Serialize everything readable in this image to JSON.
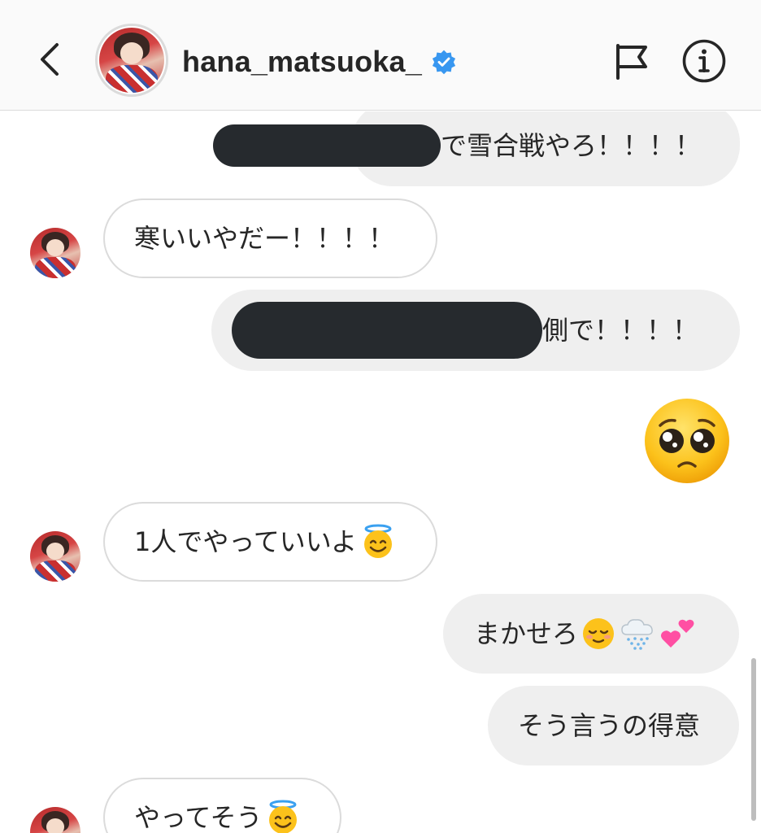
{
  "header": {
    "username": "hana_matsuoka_",
    "verified": true,
    "icons": [
      "back-icon",
      "verified-badge-icon",
      "flag-icon",
      "info-icon"
    ],
    "accent_color": "#3897f0"
  },
  "messages": [
    {
      "direction": "outgoing",
      "redacted": true,
      "text": "で雪合戦やろ！！！！"
    },
    {
      "direction": "incoming",
      "text": "寒いいやだー！！！！"
    },
    {
      "direction": "outgoing",
      "redacted": true,
      "text": "側で！！！！"
    },
    {
      "direction": "outgoing",
      "emoji_only": "pleading-face-emoji"
    },
    {
      "direction": "incoming",
      "text": "1人でやっていいよ",
      "emoji": "smiling-face-with-halo-emoji"
    },
    {
      "direction": "outgoing",
      "text": "まかせろ",
      "emoji": [
        "relieved-face-emoji",
        "cloud-with-snow-emoji",
        "two-hearts-emoji"
      ]
    },
    {
      "direction": "outgoing",
      "text": "そう言うの得意"
    },
    {
      "direction": "incoming",
      "text": "やってそう",
      "emoji": "smiling-face-with-halo-emoji"
    }
  ]
}
